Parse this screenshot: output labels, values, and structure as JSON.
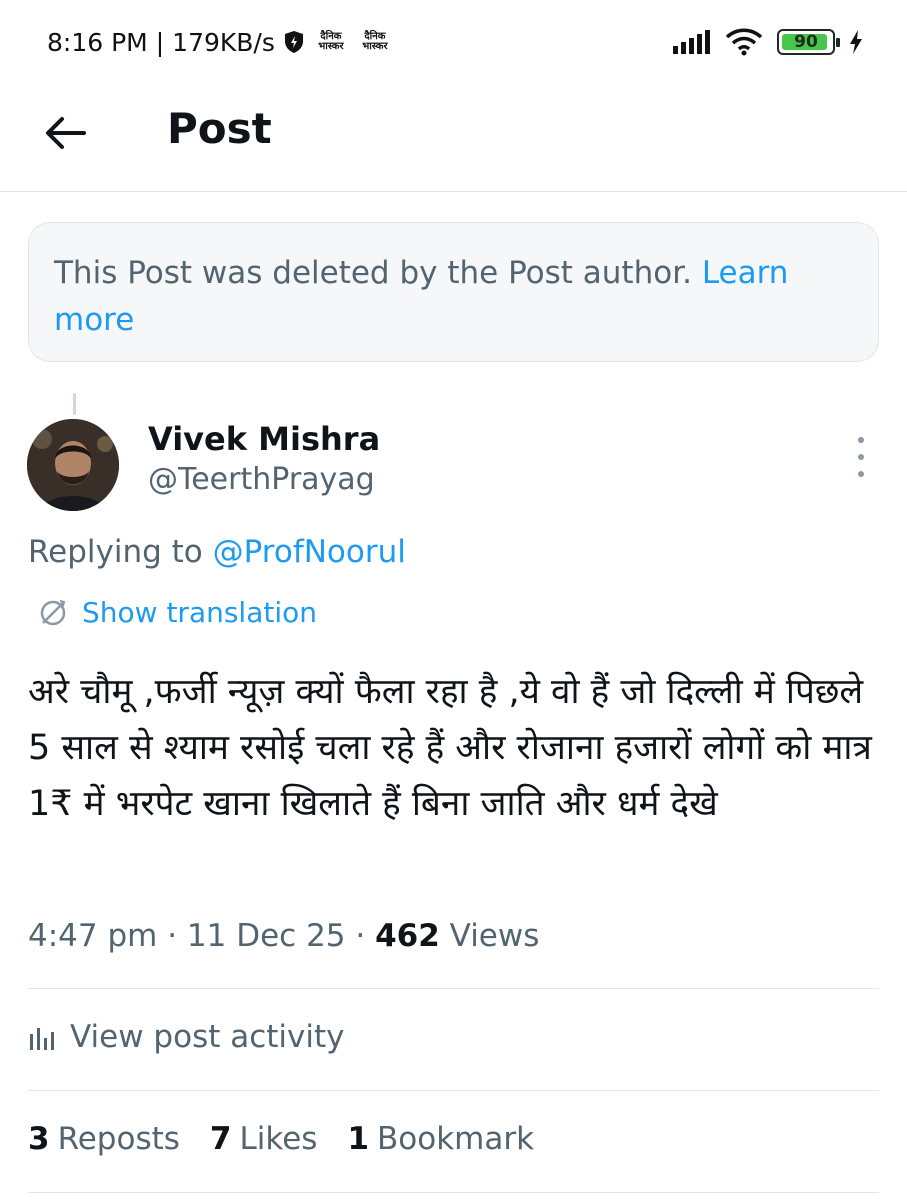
{
  "status_bar": {
    "time": "8:16 PM",
    "separator": "|",
    "speed": "179KB/s",
    "news_app_line1": "दैनिक",
    "news_app_line2": "भास्कर",
    "battery": "90",
    "battery_color": "#47c64c"
  },
  "header": {
    "title": "Post"
  },
  "deleted_notice": {
    "text": "This Post was deleted by the Post author.",
    "link": "Learn more"
  },
  "author": {
    "name": "Vivek Mishra",
    "handle": "@TeerthPrayag"
  },
  "replying": {
    "prefix": "Replying to",
    "handle": "@ProfNoorul"
  },
  "translate_label": "Show translation",
  "post_text": "अरे चौमू ,फर्जी न्यूज़ क्यों फैला रहा है ,ये वो हैं जो दिल्ली में पिछले 5 साल से श्याम रसोई चला रहे हैं और रोजाना हजारों लोगों को मात्र 1₹ में भरपेट खाना खिलाते हैं बिना जाति और धर्म देखे",
  "meta": {
    "time": "4:47 pm",
    "dot": "·",
    "date": "11 Dec 25",
    "views_count": "462",
    "views_label": "Views"
  },
  "activity_label": "View post activity",
  "stats": {
    "reposts_count": "3",
    "reposts_label": "Reposts",
    "likes_count": "7",
    "likes_label": "Likes",
    "bookmarks_count": "1",
    "bookmarks_label": "Bookmark"
  },
  "colors": {
    "link": "#1d9bf0",
    "secondary_text": "#536471",
    "primary_text": "#0f1419"
  }
}
